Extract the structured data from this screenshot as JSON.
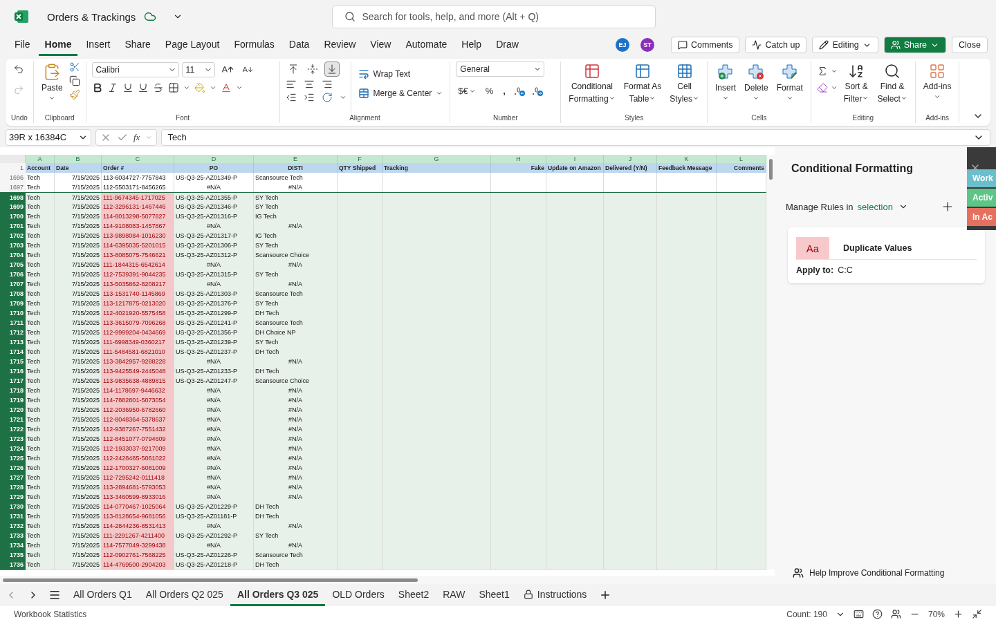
{
  "title_bar": {
    "title": "Orders & Trackings",
    "search_placeholder": "Search for tools, help, and more (Alt + Q)"
  },
  "menu": [
    {
      "label": "File",
      "selected": false
    },
    {
      "label": "Home",
      "selected": true
    },
    {
      "label": "Insert",
      "selected": false
    },
    {
      "label": "Share",
      "selected": false
    },
    {
      "label": "Page Layout",
      "selected": false
    },
    {
      "label": "Formulas",
      "selected": false
    },
    {
      "label": "Data",
      "selected": false
    },
    {
      "label": "Review",
      "selected": false
    },
    {
      "label": "View",
      "selected": false
    },
    {
      "label": "Automate",
      "selected": false
    },
    {
      "label": "Help",
      "selected": false
    },
    {
      "label": "Draw",
      "selected": false
    }
  ],
  "avatars": [
    {
      "initials": "EJ",
      "color": "#1a73c9"
    },
    {
      "initials": "ST",
      "color": "#8a2fb8"
    }
  ],
  "actions": {
    "comments": "Comments",
    "catch_up": "Catch up",
    "editing": "Editing",
    "share": "Share",
    "close": "Close"
  },
  "ribbon": {
    "undo": {
      "label": "Undo",
      "redo_disabled": true
    },
    "clipboard": {
      "label": "Clipboard",
      "paste": "Paste"
    },
    "font": {
      "label": "Font",
      "family": "Calibri",
      "size": "11"
    },
    "alignment": {
      "label": "Alignment",
      "vertical": [
        {
          "selected": false
        },
        {
          "selected": false
        },
        {
          "selected": true
        }
      ],
      "wrap": "Wrap Text",
      "merge": "Merge & Center"
    },
    "number": {
      "label": "Number",
      "format": "General",
      "currency": "$€",
      "percent": "%",
      "comma": ","
    },
    "styles": {
      "label": "Styles",
      "buttons": [
        {
          "lines": [
            "Conditional",
            "Formatting"
          ]
        },
        {
          "lines": [
            "Format As",
            "Table"
          ]
        },
        {
          "lines": [
            "Cell",
            "Styles"
          ]
        }
      ]
    },
    "cells": {
      "label": "Cells",
      "buttons": [
        {
          "lines": [
            "Insert"
          ]
        },
        {
          "lines": [
            "Delete"
          ]
        },
        {
          "lines": [
            "Format"
          ]
        }
      ]
    },
    "editing": {
      "label": "Editing",
      "buttons": [
        {
          "lines": [
            "Sort &",
            "Filter"
          ]
        },
        {
          "lines": [
            "Find &",
            "Select"
          ]
        }
      ]
    },
    "addins": {
      "label": "Add-ins",
      "buttons": [
        {
          "lines": [
            "Add-ins"
          ]
        }
      ]
    }
  },
  "formula_bar": {
    "name_box": "39R x 16384C",
    "function_symbol": "fx",
    "value": "Tech"
  },
  "sheet": {
    "columns": [
      {
        "letter": "A",
        "header": "Account"
      },
      {
        "letter": "B",
        "header": "Date"
      },
      {
        "letter": "C",
        "header": "Order #"
      },
      {
        "letter": "D",
        "header": "PO"
      },
      {
        "letter": "E",
        "header": "DISTI"
      },
      {
        "letter": "F",
        "header": "QTY Shipped"
      },
      {
        "letter": "G",
        "header": "Tracking"
      },
      {
        "letter": "H",
        "header": "Fake"
      },
      {
        "letter": "I",
        "header": "Update on Amazon"
      },
      {
        "letter": "J",
        "header": "Delivered (Y/N)"
      },
      {
        "letter": "K",
        "header": "Feedback Message"
      },
      {
        "letter": "L",
        "header": "Comments"
      }
    ],
    "header_row": "1",
    "rows": [
      {
        "n": "1696",
        "account": "Tech",
        "date": "7/15/2025",
        "order": "113-6034727-7757843",
        "po": "US-Q3-25-AZ01349-P",
        "disti": "Scansource Tech",
        "lookup_error": false,
        "selected": false,
        "duplicate": false
      },
      {
        "n": "1697",
        "account": "Tech",
        "date": "7/15/2025",
        "order": "112-5503171-8456265",
        "po": "#N/A",
        "disti": "#N/A",
        "lookup_error": true,
        "selected": false,
        "duplicate": false
      },
      {
        "n": "1698",
        "account": "Tech",
        "date": "7/15/2025",
        "order": "111-9674345-1717025",
        "po": "US-Q3-25-AZ01355-P",
        "disti": "SY Tech",
        "lookup_error": false,
        "selected": true,
        "duplicate": true
      },
      {
        "n": "1699",
        "account": "Tech",
        "date": "7/15/2025",
        "order": "112-3296131-1467446",
        "po": "US-Q3-25-AZ01346-P",
        "disti": "SY Tech",
        "lookup_error": false,
        "selected": true,
        "duplicate": true
      },
      {
        "n": "1700",
        "account": "Tech",
        "date": "7/15/2025",
        "order": "114-8013298-5077827",
        "po": "US-Q3-25-AZ01316-P",
        "disti": "IG Tech",
        "lookup_error": false,
        "selected": true,
        "duplicate": true
      },
      {
        "n": "1701",
        "account": "Tech",
        "date": "7/15/2025",
        "order": "114-9108083-1457867",
        "po": "#N/A",
        "disti": "#N/A",
        "lookup_error": true,
        "selected": true,
        "duplicate": true
      },
      {
        "n": "1702",
        "account": "Tech",
        "date": "7/15/2025",
        "order": "113-9898084-1016230",
        "po": "US-Q3-25-AZ01317-P",
        "disti": "IG Tech",
        "lookup_error": false,
        "selected": true,
        "duplicate": true
      },
      {
        "n": "1703",
        "account": "Tech",
        "date": "7/15/2025",
        "order": "114-6395035-5201015",
        "po": "US-Q3-25-AZ01306-P",
        "disti": "SY Tech",
        "lookup_error": false,
        "selected": true,
        "duplicate": true
      },
      {
        "n": "1704",
        "account": "Tech",
        "date": "7/15/2025",
        "order": "113-8085075-7546621",
        "po": "US-Q3-25-AZ01312-P",
        "disti": "Scansource Choice",
        "lookup_error": false,
        "selected": true,
        "duplicate": true
      },
      {
        "n": "1705",
        "account": "Tech",
        "date": "7/15/2025",
        "order": "111-1844315-6542614",
        "po": "#N/A",
        "disti": "#N/A",
        "lookup_error": true,
        "selected": true,
        "duplicate": true
      },
      {
        "n": "1706",
        "account": "Tech",
        "date": "7/15/2025",
        "order": "112-7539391-9044235",
        "po": "US-Q3-25-AZ01315-P",
        "disti": "SY Tech",
        "lookup_error": false,
        "selected": true,
        "duplicate": true
      },
      {
        "n": "1707",
        "account": "Tech",
        "date": "7/15/2025",
        "order": "113-5035862-8208217",
        "po": "#N/A",
        "disti": "#N/A",
        "lookup_error": true,
        "selected": true,
        "duplicate": true
      },
      {
        "n": "1708",
        "account": "Tech",
        "date": "7/15/2025",
        "order": "113-1531740-1145869",
        "po": "US-Q3-25-AZ01303-P",
        "disti": "Scansource Tech",
        "lookup_error": false,
        "selected": true,
        "duplicate": true
      },
      {
        "n": "1709",
        "account": "Tech",
        "date": "7/15/2025",
        "order": "113-1217875-0213020",
        "po": "US-Q3-25-AZ01376-P",
        "disti": "SY Tech",
        "lookup_error": false,
        "selected": true,
        "duplicate": true
      },
      {
        "n": "1710",
        "account": "Tech",
        "date": "7/15/2025",
        "order": "112-4021920-5575458",
        "po": "US-Q3-25-AZ01299-P",
        "disti": "DH Tech",
        "lookup_error": false,
        "selected": true,
        "duplicate": true
      },
      {
        "n": "1711",
        "account": "Tech",
        "date": "7/15/2025",
        "order": "113-3615079-7096268",
        "po": "US-Q3-25-AZ01241-P",
        "disti": "Scansource Tech",
        "lookup_error": false,
        "selected": true,
        "duplicate": true
      },
      {
        "n": "1712",
        "account": "Tech",
        "date": "7/15/2025",
        "order": "112-9999204-0434669",
        "po": "US-Q3-25-AZ01356-P",
        "disti": "DH Choice NP",
        "lookup_error": false,
        "selected": true,
        "duplicate": true
      },
      {
        "n": "1713",
        "account": "Tech",
        "date": "7/15/2025",
        "order": "111-6998349-0360217",
        "po": "US-Q3-25-AZ01239-P",
        "disti": "SY Tech",
        "lookup_error": false,
        "selected": true,
        "duplicate": true
      },
      {
        "n": "1714",
        "account": "Tech",
        "date": "7/15/2025",
        "order": "111-5484581-6821010",
        "po": "US-Q3-25-AZ01237-P",
        "disti": "DH Tech",
        "lookup_error": false,
        "selected": true,
        "duplicate": true
      },
      {
        "n": "1715",
        "account": "Tech",
        "date": "7/15/2025",
        "order": "113-3842957-9288228",
        "po": "#N/A",
        "disti": "#N/A",
        "lookup_error": true,
        "selected": true,
        "duplicate": true
      },
      {
        "n": "1716",
        "account": "Tech",
        "date": "7/15/2025",
        "order": "113-9425549-2445048",
        "po": "US-Q3-25-AZ01233-P",
        "disti": "DH Tech",
        "lookup_error": false,
        "selected": true,
        "duplicate": true
      },
      {
        "n": "1717",
        "account": "Tech",
        "date": "7/15/2025",
        "order": "113-9835638-4889815",
        "po": "US-Q3-25-AZ01247-P",
        "disti": "Scansource Choice",
        "lookup_error": false,
        "selected": true,
        "duplicate": true
      },
      {
        "n": "1718",
        "account": "Tech",
        "date": "7/15/2025",
        "order": "114-1178697-9446632",
        "po": "#N/A",
        "disti": "#N/A",
        "lookup_error": true,
        "selected": true,
        "duplicate": true
      },
      {
        "n": "1719",
        "account": "Tech",
        "date": "7/15/2025",
        "order": "114-7882801-5073054",
        "po": "#N/A",
        "disti": "#N/A",
        "lookup_error": true,
        "selected": true,
        "duplicate": true
      },
      {
        "n": "1720",
        "account": "Tech",
        "date": "7/15/2025",
        "order": "112-2036950-6782660",
        "po": "#N/A",
        "disti": "#N/A",
        "lookup_error": true,
        "selected": true,
        "duplicate": true
      },
      {
        "n": "1721",
        "account": "Tech",
        "date": "7/15/2025",
        "order": "112-8048364-5378637",
        "po": "#N/A",
        "disti": "#N/A",
        "lookup_error": true,
        "selected": true,
        "duplicate": true
      },
      {
        "n": "1722",
        "account": "Tech",
        "date": "7/15/2025",
        "order": "112-9387267-7551432",
        "po": "#N/A",
        "disti": "#N/A",
        "lookup_error": true,
        "selected": true,
        "duplicate": true
      },
      {
        "n": "1723",
        "account": "Tech",
        "date": "7/15/2025",
        "order": "112-8451077-0794609",
        "po": "#N/A",
        "disti": "#N/A",
        "lookup_error": true,
        "selected": true,
        "duplicate": true
      },
      {
        "n": "1724",
        "account": "Tech",
        "date": "7/15/2025",
        "order": "112-1933037-9217009",
        "po": "#N/A",
        "disti": "#N/A",
        "lookup_error": true,
        "selected": true,
        "duplicate": true
      },
      {
        "n": "1725",
        "account": "Tech",
        "date": "7/15/2025",
        "order": "112-2428485-5061022",
        "po": "#N/A",
        "disti": "#N/A",
        "lookup_error": true,
        "selected": true,
        "duplicate": true
      },
      {
        "n": "1726",
        "account": "Tech",
        "date": "7/15/2025",
        "order": "112-1700327-6081009",
        "po": "#N/A",
        "disti": "#N/A",
        "lookup_error": true,
        "selected": true,
        "duplicate": true
      },
      {
        "n": "1727",
        "account": "Tech",
        "date": "7/15/2025",
        "order": "112-7295242-0111418",
        "po": "#N/A",
        "disti": "#N/A",
        "lookup_error": true,
        "selected": true,
        "duplicate": true
      },
      {
        "n": "1728",
        "account": "Tech",
        "date": "7/15/2025",
        "order": "113-2894681-5793053",
        "po": "#N/A",
        "disti": "#N/A",
        "lookup_error": true,
        "selected": true,
        "duplicate": true
      },
      {
        "n": "1729",
        "account": "Tech",
        "date": "7/15/2025",
        "order": "113-3460599-8933016",
        "po": "#N/A",
        "disti": "#N/A",
        "lookup_error": true,
        "selected": true,
        "duplicate": true
      },
      {
        "n": "1730",
        "account": "Tech",
        "date": "7/15/2025",
        "order": "114-0770467-1025064",
        "po": "US-Q3-25-AZ01229-P",
        "disti": "DH Tech",
        "lookup_error": false,
        "selected": true,
        "duplicate": true
      },
      {
        "n": "1731",
        "account": "Tech",
        "date": "7/15/2025",
        "order": "113-8128654-9681056",
        "po": "US-Q3-25-AZ01181-P",
        "disti": "DH Tech",
        "lookup_error": false,
        "selected": true,
        "duplicate": true
      },
      {
        "n": "1732",
        "account": "Tech",
        "date": "7/15/2025",
        "order": "114-2844236-8531413",
        "po": "#N/A",
        "disti": "#N/A",
        "lookup_error": true,
        "selected": true,
        "duplicate": true
      },
      {
        "n": "1733",
        "account": "Tech",
        "date": "7/15/2025",
        "order": "111-2291267-4211400",
        "po": "US-Q3-25-AZ01292-P",
        "disti": "SY Tech",
        "lookup_error": false,
        "selected": true,
        "duplicate": true
      },
      {
        "n": "1734",
        "account": "Tech",
        "date": "7/15/2025",
        "order": "114-7577049-3299438",
        "po": "#N/A",
        "disti": "#N/A",
        "lookup_error": true,
        "selected": true,
        "duplicate": true
      },
      {
        "n": "1735",
        "account": "Tech",
        "date": "7/15/2025",
        "order": "112-0902761-7568225",
        "po": "US-Q3-25-AZ01226-P",
        "disti": "Scansource Tech",
        "lookup_error": false,
        "selected": true,
        "duplicate": true
      },
      {
        "n": "1736",
        "account": "Tech",
        "date": "7/15/2025",
        "order": "114-4769500-2904203",
        "po": "US-Q3-25-AZ01218-P",
        "disti": "DH Tech",
        "lookup_error": false,
        "selected": true,
        "duplicate": true
      }
    ]
  },
  "panel": {
    "title": "Conditional Formatting",
    "manage_label": "Manage Rules in",
    "scope": "selection",
    "rules": [
      {
        "preview": "Aa",
        "name": "Duplicate Values",
        "apply_label": "Apply to:",
        "range": "C:C"
      }
    ],
    "footer": "Help Improve Conditional Formatting"
  },
  "overlay_tabs": [
    {
      "label": "Work",
      "color": "#6bbfcd"
    },
    {
      "label": "Activ",
      "color": "#5cc587"
    },
    {
      "label": "In Ac",
      "color": "#e5705f"
    }
  ],
  "sheet_tabs": [
    {
      "label": "All Orders Q1",
      "selected": false,
      "locked": false
    },
    {
      "label": "All Orders Q2 025",
      "selected": false,
      "locked": false
    },
    {
      "label": "All Orders Q3 025",
      "selected": true,
      "locked": false
    },
    {
      "label": "OLD Orders",
      "selected": false,
      "locked": false
    },
    {
      "label": "Sheet2",
      "selected": false,
      "locked": false
    },
    {
      "label": "RAW",
      "selected": false,
      "locked": false
    },
    {
      "label": "Sheet1",
      "selected": false,
      "locked": false
    },
    {
      "label": "Instructions",
      "selected": false,
      "locked": true
    }
  ],
  "status_bar": {
    "left": "Workbook Statistics",
    "count": "Count: 190",
    "zoom": "70%"
  }
}
